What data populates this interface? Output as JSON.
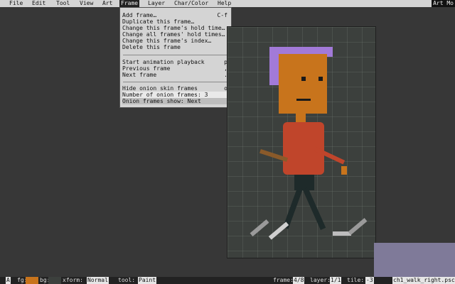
{
  "menubar": {
    "items": [
      {
        "label": "File"
      },
      {
        "label": "Edit"
      },
      {
        "label": "Tool"
      },
      {
        "label": "View"
      },
      {
        "label": "Art"
      },
      {
        "label": "Frame"
      },
      {
        "label": "Layer"
      },
      {
        "label": "Char/Color"
      },
      {
        "label": "Help"
      }
    ],
    "right_label": "Art Mo"
  },
  "frame_menu": {
    "items": [
      {
        "label": "Add frame…",
        "shortcut": "C-f"
      },
      {
        "label": "Duplicate this frame…",
        "shortcut": ""
      },
      {
        "label": "Change this frame's hold time…",
        "shortcut": ""
      },
      {
        "label": "Change all frames' hold times…",
        "shortcut": ""
      },
      {
        "label": "Change this frame's index…",
        "shortcut": ""
      },
      {
        "label": "Delete this frame",
        "shortcut": ""
      },
      {
        "label": "Start animation playback",
        "shortcut": "p"
      },
      {
        "label": "Previous frame",
        "shortcut": ","
      },
      {
        "label": "Next frame",
        "shortcut": "."
      },
      {
        "label": "Hide onion skin frames",
        "shortcut": "o"
      },
      {
        "label": "Number of onion frames: 3",
        "shortcut": ""
      },
      {
        "label": "Onion frames show: Next",
        "shortcut": ""
      }
    ]
  },
  "statusbar": {
    "char_label": "A",
    "fg_label": "fg:",
    "bg_label": "bg:",
    "xform_label": "xform:",
    "xform_value": "Normal",
    "tool_label": "tool:",
    "tool_value": "Paint",
    "frame_label": "frame:",
    "frame_value": "4/8",
    "layer_label": "layer:",
    "layer_value": "1/1",
    "tile_label": "tile:",
    "tile_value": "-3",
    "filename": "ch1_walk_right.psc"
  },
  "colors": {
    "menubar_bg": "#d4d4d4",
    "workspace_bg": "#373737",
    "skin": "#c8741c",
    "hair": "#a27ad8",
    "shirt": "#c0452b",
    "pants": "#1e2a2a",
    "shoes": "#c0c0c0"
  },
  "icons": {
    "preview_thumbnail": "frame-preview-icon"
  }
}
